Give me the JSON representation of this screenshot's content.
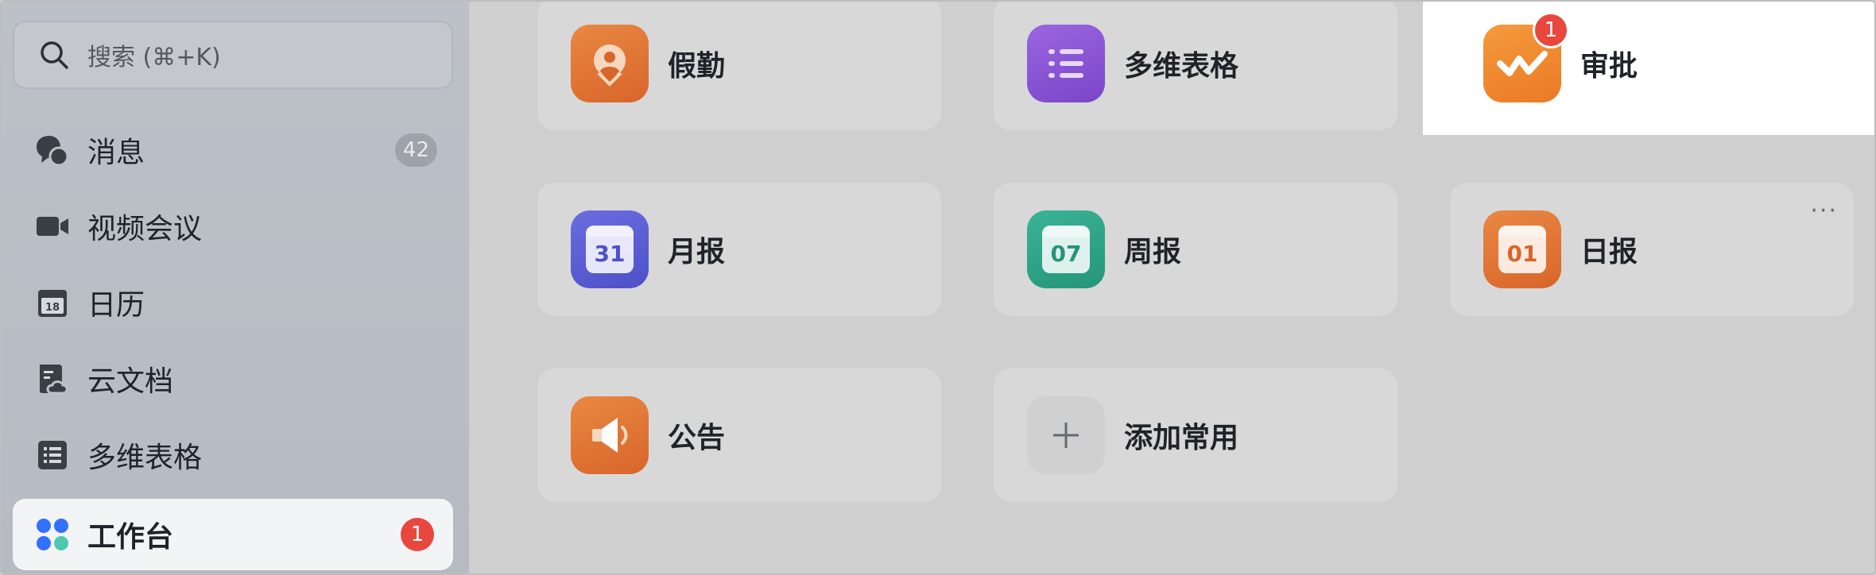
{
  "search": {
    "label": "搜索 (⌘+K)"
  },
  "sidebar": {
    "items": [
      {
        "label": "消息",
        "icon": "chat-bubbles-icon",
        "count": "42"
      },
      {
        "label": "视频会议",
        "icon": "video-camera-icon"
      },
      {
        "label": "日历",
        "icon": "calendar-icon",
        "date": "18"
      },
      {
        "label": "云文档",
        "icon": "cloud-doc-icon"
      },
      {
        "label": "多维表格",
        "icon": "list-table-icon"
      },
      {
        "label": "工作台",
        "icon": "workspace-grid-icon",
        "badge": "1",
        "active": true
      }
    ]
  },
  "apps": [
    {
      "label": "假勤",
      "icon": "attendance-icon",
      "color": "#e27630"
    },
    {
      "label": "多维表格",
      "icon": "multi-table-icon",
      "color": "#8b54d6"
    },
    {
      "label": "审批",
      "icon": "approval-icon",
      "color": "#f08a2e",
      "badge": "1"
    },
    {
      "label": "月报",
      "icon": "monthly-report-icon",
      "color": "#5b5fd6",
      "num": "31"
    },
    {
      "label": "周报",
      "icon": "weekly-report-icon",
      "color": "#2fa58a",
      "num": "07"
    },
    {
      "label": "日报",
      "icon": "daily-report-icon",
      "color": "#e27630",
      "num": "01",
      "more": "···"
    },
    {
      "label": "公告",
      "icon": "announcement-icon",
      "color": "#e27630"
    },
    {
      "label": "添加常用",
      "icon": "plus-icon",
      "color": "#d0d0d0"
    }
  ],
  "colors": {
    "accent": "#3370ff",
    "badge": "#e8473e"
  }
}
